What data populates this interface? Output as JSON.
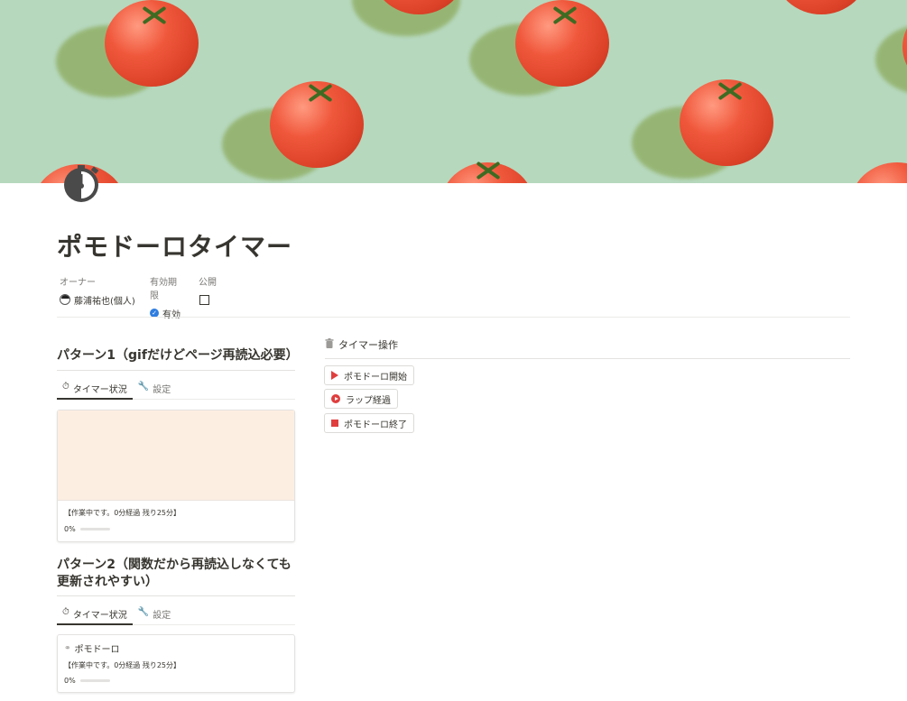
{
  "page": {
    "title": "ポモドーロタイマー"
  },
  "properties": [
    {
      "label": "オーナー",
      "value": "藤浦祐也(個人)",
      "kind": "person"
    },
    {
      "label": "有効期限",
      "value": "有効",
      "kind": "verified"
    },
    {
      "label": "公開",
      "value": "",
      "kind": "checkbox",
      "checked": false
    }
  ],
  "pattern1": {
    "title": "パターン1（gifだけどページ再読込必要）",
    "tabs": [
      {
        "label": "タイマー状況",
        "active": true,
        "icon": "stopwatch-icon"
      },
      {
        "label": "設定",
        "active": false,
        "icon": "wrench-icon"
      }
    ],
    "card": {
      "status": "【作業中です。0分経過 残り25分】",
      "progress_label": "0%",
      "progress": 0
    }
  },
  "pattern2": {
    "title": "パターン2（関数だから再読込しなくても更新されやすい）",
    "tabs": [
      {
        "label": "タイマー状況",
        "active": true,
        "icon": "stopwatch-icon"
      },
      {
        "label": "設定",
        "active": false,
        "icon": "wrench-icon"
      }
    ],
    "card": {
      "title": "ポモドーロ",
      "status": "【作業中です。0分経過 残り25分】",
      "progress_label": "0%",
      "progress": 0
    }
  },
  "timer_ops": {
    "heading": "タイマー操作",
    "buttons": [
      {
        "label": "ポモドーロ開始",
        "icon": "play-icon"
      },
      {
        "label": "ラップ経過",
        "icon": "play-circle-icon"
      },
      {
        "label": "ポモドーロ終了",
        "icon": "stop-icon"
      }
    ]
  },
  "colors": {
    "cover_bg": "#b6d8bd",
    "card_cover": "#fdeee2",
    "accent_red": "#e03e3e",
    "verified_blue": "#2e7de0"
  }
}
